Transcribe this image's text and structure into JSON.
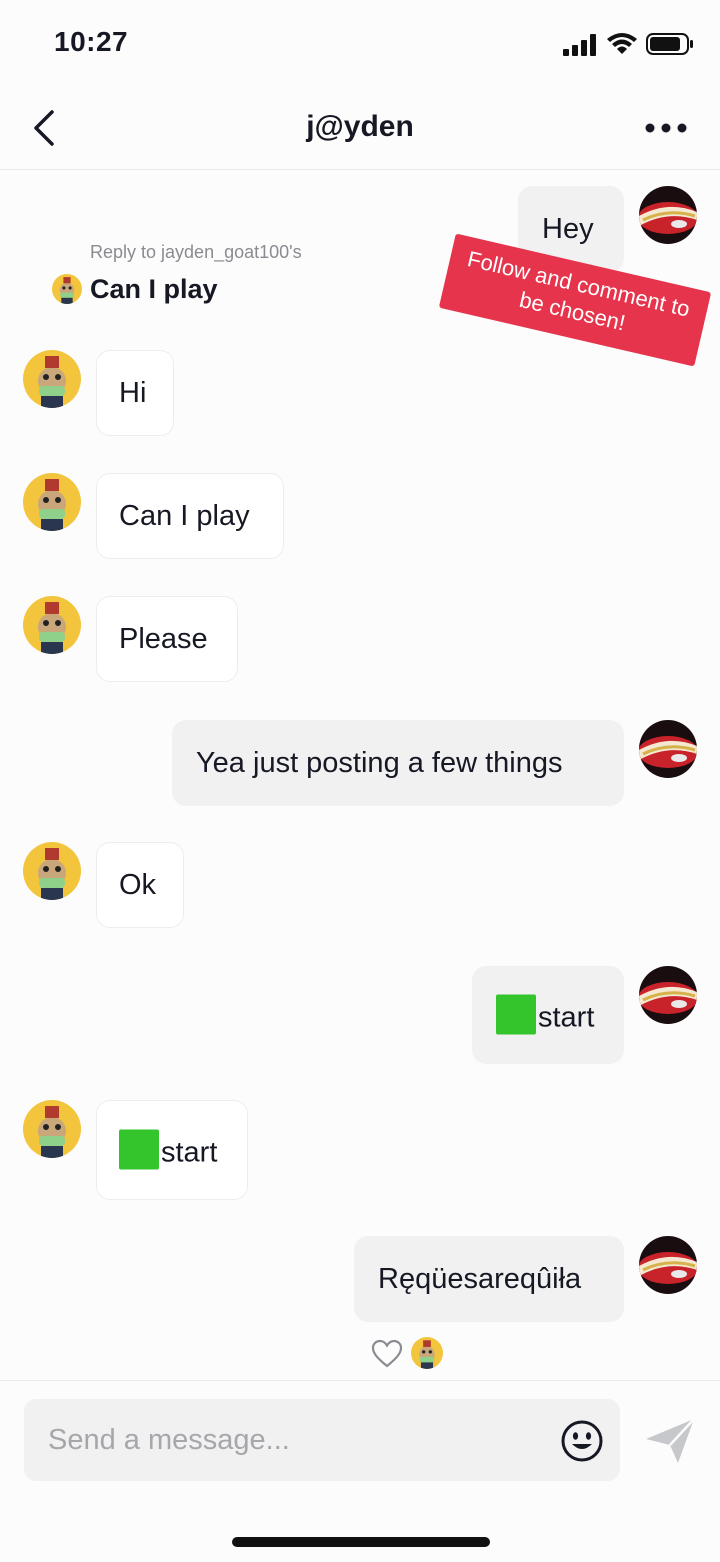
{
  "status_bar": {
    "time": "10:27"
  },
  "header": {
    "title": "j@yden"
  },
  "reply": {
    "label": "Reply to jayden_goat100's",
    "text": "Can I play"
  },
  "promo": {
    "line1": "Follow and comment to",
    "line2": "be chosen!"
  },
  "messages": [
    {
      "from": "me",
      "text": "Hey"
    },
    {
      "from": "them",
      "text": "Hi"
    },
    {
      "from": "them",
      "text": "Can I play"
    },
    {
      "from": "them",
      "text": "Please"
    },
    {
      "from": "me",
      "text": "Yea just posting a few things"
    },
    {
      "from": "them",
      "text": "Ok"
    },
    {
      "from": "me",
      "text": "start",
      "emoji": "green-square"
    },
    {
      "from": "them",
      "text": "start",
      "emoji": "green-square"
    },
    {
      "from": "me",
      "text": "Ręqüesareqûiła"
    }
  ],
  "input": {
    "placeholder": "Send a message..."
  },
  "icons": {
    "back": "chevron-left-icon",
    "more": "ellipsis-icon",
    "reaction": "heart-icon",
    "emoji": "smiley-icon",
    "send": "send-icon"
  },
  "colors": {
    "promo": "#e5344b",
    "green_square": "#33c52b",
    "outgoing_bubble": "#f1f1f2",
    "incoming_bubble": "#ffffff"
  }
}
